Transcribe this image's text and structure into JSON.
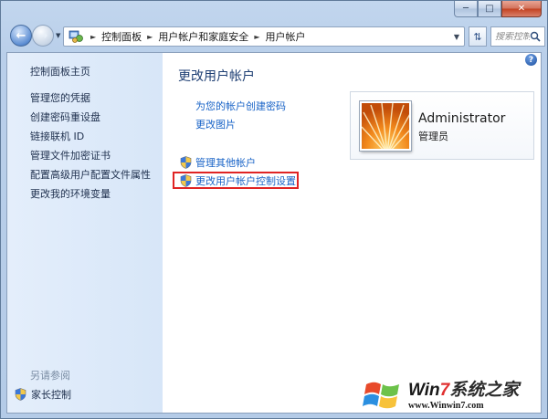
{
  "nav": {
    "breadcrumbs": [
      "控制面板",
      "用户帐户和家庭安全",
      "用户帐户"
    ],
    "search_placeholder": "搜索控制面板"
  },
  "sidebar": {
    "home": "控制面板主页",
    "items": [
      "管理您的凭据",
      "创建密码重设盘",
      "链接联机 ID",
      "管理文件加密证书",
      "配置高级用户配置文件属性",
      "更改我的环境变量"
    ],
    "see_also": "另请参阅",
    "parental_control": "家长控制"
  },
  "main": {
    "title": "更改用户帐户",
    "links": [
      "为您的帐户创建密码",
      "更改图片"
    ],
    "shield_links": [
      "管理其他帐户",
      "更改用户帐户控制设置"
    ],
    "help": "?"
  },
  "user": {
    "name": "Administrator",
    "role": "管理员"
  },
  "watermark": {
    "brand_prefix": "Win",
    "brand_seven": "7",
    "brand_suffix": "系统之家",
    "url": "www.Winwin7.com"
  },
  "colors": {
    "link": "#1863c7",
    "highlight": "#e02424",
    "title": "#1d3e73"
  }
}
